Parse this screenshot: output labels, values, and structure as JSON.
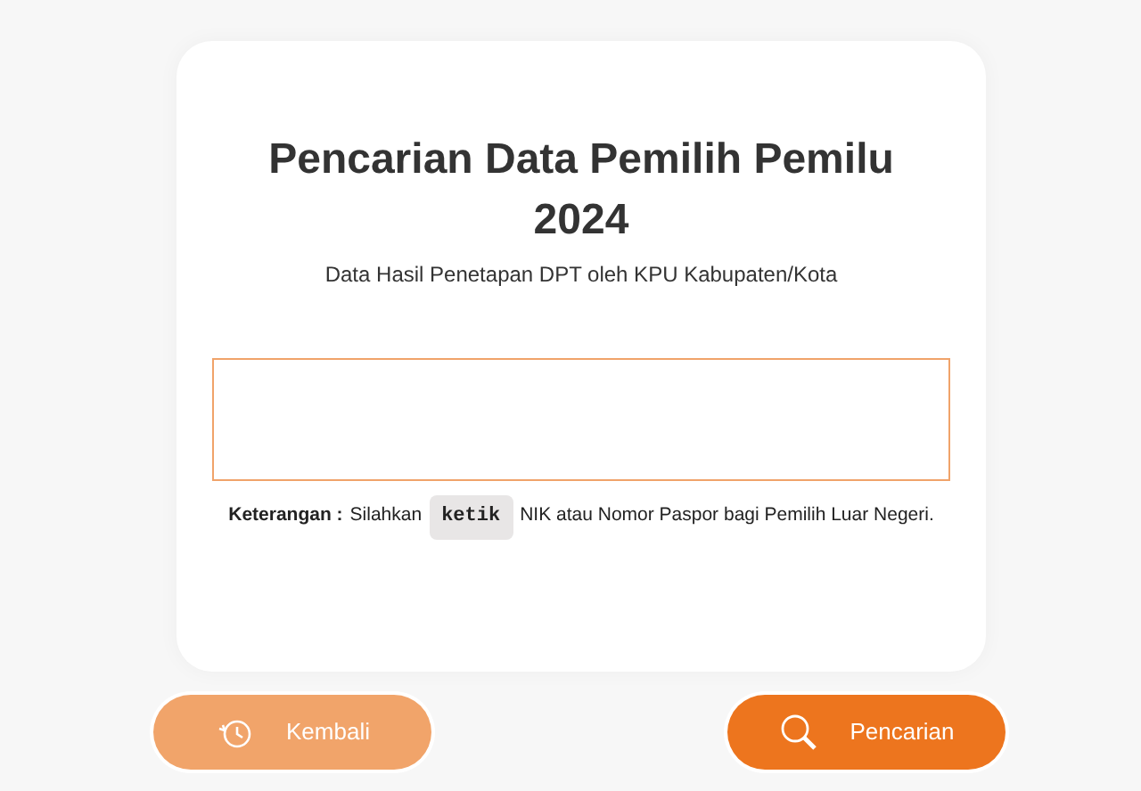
{
  "card": {
    "title": "Pencarian Data Pemilih Pemilu 2024",
    "subtitle": "Data Hasil Penetapan DPT oleh KPU Kabupaten/Kota",
    "note": {
      "label": "Keterangan :",
      "before": "Silahkan",
      "key": "ketik",
      "after": "NIK atau Nomor Paspor bagi Pemilih Luar Negeri."
    }
  },
  "buttons": [
    {
      "label": "Kembali",
      "kind": "back"
    },
    {
      "label": "Pencarian",
      "kind": "search"
    }
  ]
}
